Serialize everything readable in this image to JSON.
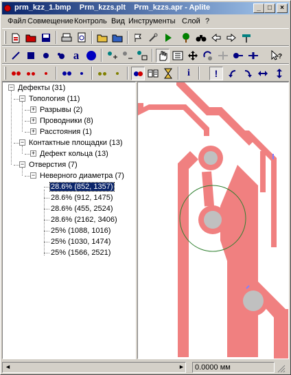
{
  "window": {
    "title": "prm_kzz_1.bmp    Prm_kzzs.plt    Prm_kzzs.apr - Aplite",
    "minimize_glyph": "_",
    "maximize_glyph": "□",
    "close_glyph": "×"
  },
  "menu": [
    "Файл",
    "Совмещение",
    "Контроль",
    "Вид",
    "Инструменты",
    "Слой",
    "?"
  ],
  "tree": {
    "root": "Дефекты (31)",
    "topology": "Топология (11)",
    "breaks": "Разрывы (2)",
    "conductors": "Проводники (8)",
    "distances": "Расстояния (1)",
    "pads": "Контактные площадки (13)",
    "ring_defect": "Дефект кольца (13)",
    "holes": "Отверстия (7)",
    "wrong_diameter": "Неверного диаметра (7)",
    "items": [
      "28.6% (852, 1357)",
      "28.6% (912, 1475)",
      "28.6% (455, 2524)",
      "28.6% (2162, 3406)",
      "25% (1088, 1016)",
      "25% (1030, 1474)",
      "25% (1566, 2521)"
    ]
  },
  "status": {
    "coords": "0.0000 мм",
    "left_arrow": "◄",
    "right_arrow": "►"
  },
  "colors": {
    "trace": "#f08080",
    "drill": "#c0c0c0",
    "marker": "#2f7f2f",
    "selection": "#0a246a"
  }
}
